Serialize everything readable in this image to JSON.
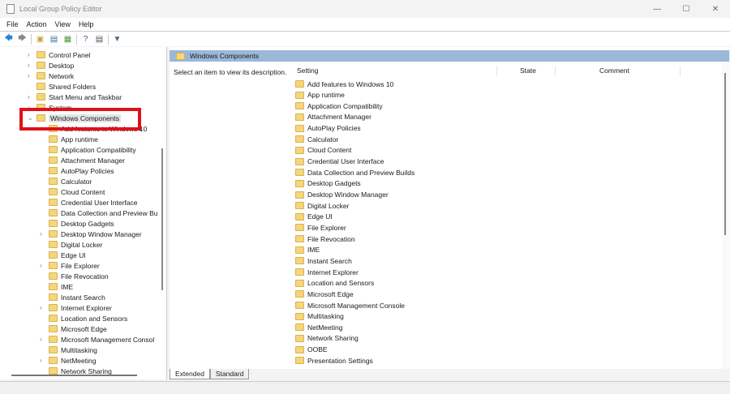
{
  "window": {
    "title": "Local Group Policy Editor",
    "minimize": "—",
    "maximize": "☐",
    "close": "✕"
  },
  "menu": [
    "File",
    "Action",
    "View",
    "Help"
  ],
  "toolbar": [
    {
      "icon": "back-arrow-icon",
      "glyph": "🡄",
      "color": "#2f7fd6"
    },
    {
      "icon": "forward-arrow-icon",
      "glyph": "🡆",
      "color": "#888888"
    },
    {
      "icon": "up-folder-icon",
      "glyph": "▣",
      "color": "#c9a63a"
    },
    {
      "icon": "show-hide-tree-icon",
      "glyph": "▤",
      "color": "#3a6ea5"
    },
    {
      "icon": "export-list-icon",
      "glyph": "▦",
      "color": "#4a9a3a"
    },
    {
      "icon": "help-icon",
      "glyph": "?",
      "color": "#2f4fa6"
    },
    {
      "icon": "properties-icon",
      "glyph": "▤",
      "color": "#555555"
    },
    {
      "icon": "filter-icon",
      "glyph": "▼",
      "color": "#4a6a8a"
    }
  ],
  "tree": [
    {
      "label": "Control Panel",
      "level": 1,
      "exp": true
    },
    {
      "label": "Desktop",
      "level": 1,
      "exp": true
    },
    {
      "label": "Network",
      "level": 1,
      "exp": true
    },
    {
      "label": "Shared Folders",
      "level": 1,
      "exp": false
    },
    {
      "label": "Start Menu and Taskbar",
      "level": 1,
      "exp": true
    },
    {
      "label": "System",
      "level": 1,
      "exp": true
    },
    {
      "label": "Windows Components",
      "level": 1,
      "exp": "open",
      "selected": true
    },
    {
      "label": "Add features to Windows 10",
      "level": 2,
      "exp": false
    },
    {
      "label": "App runtime",
      "level": 2,
      "exp": false
    },
    {
      "label": "Application Compatibility",
      "level": 2,
      "exp": false
    },
    {
      "label": "Attachment Manager",
      "level": 2,
      "exp": false
    },
    {
      "label": "AutoPlay Policies",
      "level": 2,
      "exp": false
    },
    {
      "label": "Calculator",
      "level": 2,
      "exp": false
    },
    {
      "label": "Cloud Content",
      "level": 2,
      "exp": false
    },
    {
      "label": "Credential User Interface",
      "level": 2,
      "exp": false
    },
    {
      "label": "Data Collection and Preview Bu",
      "level": 2,
      "exp": false
    },
    {
      "label": "Desktop Gadgets",
      "level": 2,
      "exp": false
    },
    {
      "label": "Desktop Window Manager",
      "level": 2,
      "exp": true
    },
    {
      "label": "Digital Locker",
      "level": 2,
      "exp": false
    },
    {
      "label": "Edge UI",
      "level": 2,
      "exp": false
    },
    {
      "label": "File Explorer",
      "level": 2,
      "exp": true
    },
    {
      "label": "File Revocation",
      "level": 2,
      "exp": false
    },
    {
      "label": "IME",
      "level": 2,
      "exp": false
    },
    {
      "label": "Instant Search",
      "level": 2,
      "exp": false
    },
    {
      "label": "Internet Explorer",
      "level": 2,
      "exp": true
    },
    {
      "label": "Location and Sensors",
      "level": 2,
      "exp": false
    },
    {
      "label": "Microsoft Edge",
      "level": 2,
      "exp": false
    },
    {
      "label": "Microsoft Management Consol",
      "level": 2,
      "exp": true
    },
    {
      "label": "Multitasking",
      "level": 2,
      "exp": false
    },
    {
      "label": "NetMeeting",
      "level": 2,
      "exp": true
    },
    {
      "label": "Network Sharing",
      "level": 2,
      "exp": false
    }
  ],
  "right": {
    "header": "Windows Components",
    "description": "Select an item to view its description.",
    "columns": {
      "setting": "Setting",
      "state": "State",
      "comment": "Comment"
    },
    "items": [
      "Add features to Windows 10",
      "App runtime",
      "Application Compatibility",
      "Attachment Manager",
      "AutoPlay Policies",
      "Calculator",
      "Cloud Content",
      "Credential User Interface",
      "Data Collection and Preview Builds",
      "Desktop Gadgets",
      "Desktop Window Manager",
      "Digital Locker",
      "Edge UI",
      "File Explorer",
      "File Revocation",
      "IME",
      "Instant Search",
      "Internet Explorer",
      "Location and Sensors",
      "Microsoft Edge",
      "Microsoft Management Console",
      "Multitasking",
      "NetMeeting",
      "Network Sharing",
      "OOBE",
      "Presentation Settings"
    ]
  },
  "tabs": [
    "Extended",
    "Standard"
  ]
}
